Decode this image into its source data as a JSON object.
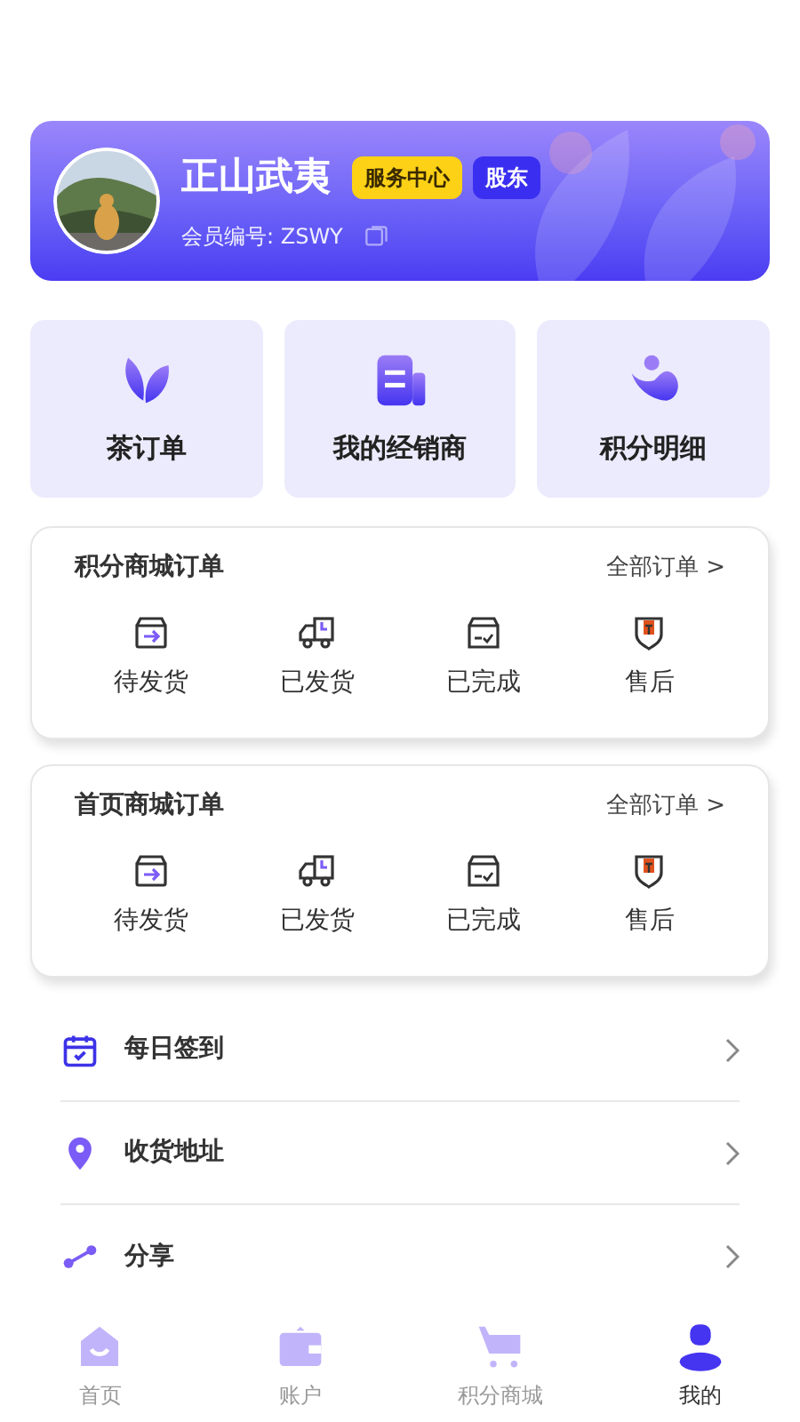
{
  "profile": {
    "name": "正山武夷",
    "badges": [
      {
        "label": "服务中心",
        "kind": "service"
      },
      {
        "label": "股东",
        "kind": "shareholder"
      }
    ],
    "member_no": "会员编号: ZSWY"
  },
  "shortcuts": [
    {
      "label": "茶订单",
      "kind": "leaf"
    },
    {
      "label": "我的经销商",
      "kind": "doc"
    },
    {
      "label": "积分明细",
      "kind": "points"
    }
  ],
  "order_sections": [
    {
      "title": "积分商城订单",
      "link": "全部订单 >",
      "statuses": [
        {
          "label": "待发货",
          "kind": "pending"
        },
        {
          "label": "已发货",
          "kind": "shipped"
        },
        {
          "label": "已完成",
          "kind": "done"
        },
        {
          "label": "售后",
          "kind": "aftersale"
        }
      ]
    },
    {
      "title": "首页商城订单",
      "link": "全部订单 >",
      "statuses": [
        {
          "label": "待发货",
          "kind": "pending"
        },
        {
          "label": "已发货",
          "kind": "shipped"
        },
        {
          "label": "已完成",
          "kind": "done"
        },
        {
          "label": "售后",
          "kind": "aftersale"
        }
      ]
    }
  ],
  "menu": [
    {
      "label": "每日签到",
      "kind": "calendar"
    },
    {
      "label": "收货地址",
      "kind": "location"
    },
    {
      "label": "分享",
      "kind": "share"
    }
  ],
  "tab_bar": [
    {
      "label": "首页",
      "kind": "home",
      "selected": false
    },
    {
      "label": "账户",
      "kind": "wallet",
      "selected": false
    },
    {
      "label": "积分商城",
      "kind": "cart",
      "selected": false
    },
    {
      "label": "我的",
      "kind": "user",
      "selected": true
    }
  ]
}
